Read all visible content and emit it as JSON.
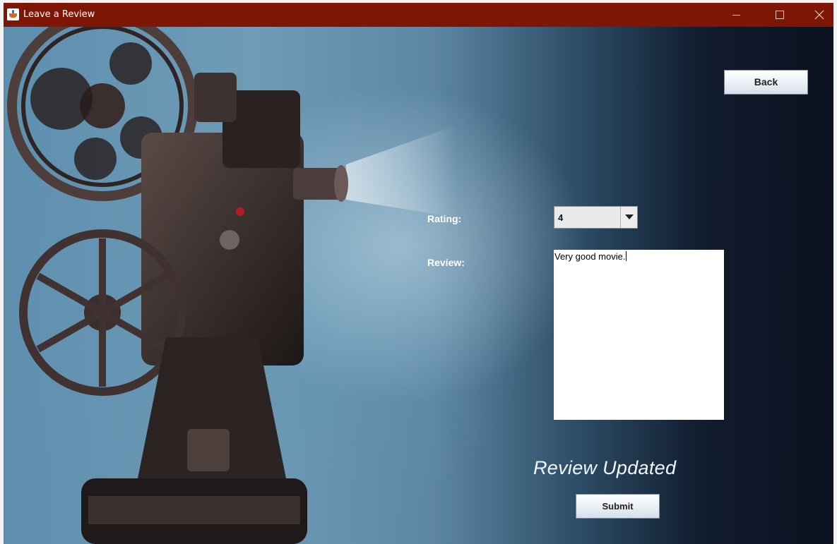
{
  "window": {
    "title": "Leave a Review"
  },
  "form": {
    "rating_label": "Rating:",
    "rating_value": "4",
    "review_label": "Review:",
    "review_text": "Very good movie."
  },
  "buttons": {
    "back_label": "Back",
    "submit_label": "Submit"
  },
  "status_message": "Review Updated",
  "icons": {
    "app": "java-app-icon",
    "minimize": "minimize-icon",
    "maximize": "maximize-icon",
    "close": "close-icon",
    "dropdown": "chevron-down-icon"
  },
  "colors": {
    "titlebar": "#7e1605",
    "label_text": "#ffffff",
    "status_text": "#f2f5f9"
  }
}
